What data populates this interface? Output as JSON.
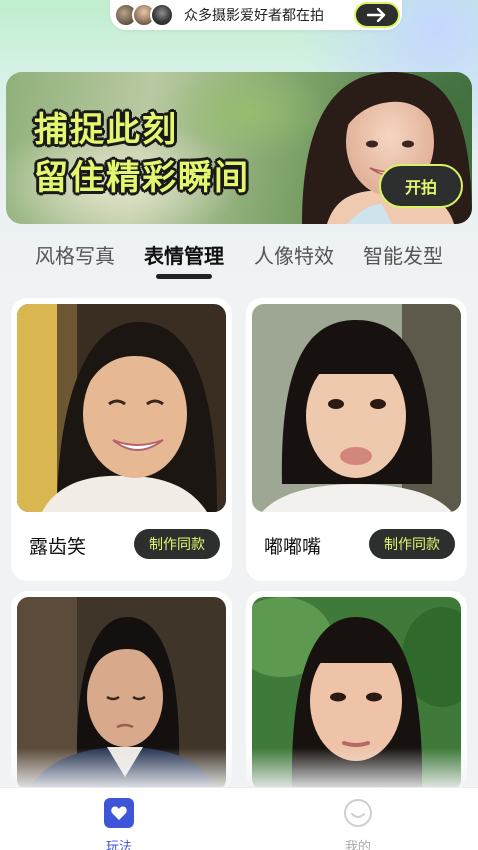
{
  "community": {
    "text": "众多摄影爱好者都在拍",
    "arrow_icon": "arrow-right-icon"
  },
  "banner": {
    "line1": "捕捉此刻",
    "line2": "留住精彩瞬间",
    "button_label": "开拍"
  },
  "tabs": [
    {
      "label": "风格写真",
      "active": false
    },
    {
      "label": "表情管理",
      "active": true
    },
    {
      "label": "人像特效",
      "active": false
    },
    {
      "label": "智能发型",
      "active": false
    }
  ],
  "cards": [
    {
      "title": "露齿笑",
      "button_label": "制作同款"
    },
    {
      "title": "嘟嘟嘴",
      "button_label": "制作同款"
    },
    {
      "title": "",
      "button_label": ""
    },
    {
      "title": "",
      "button_label": ""
    }
  ],
  "bottom_nav": [
    {
      "label": "玩法",
      "icon": "heart-icon",
      "active": true
    },
    {
      "label": "我的",
      "icon": "smiley-icon",
      "active": false
    }
  ],
  "colors": {
    "accent_lime": "#e4f76e",
    "dark_button": "#2c2f2e",
    "nav_active": "#3f55d9"
  }
}
